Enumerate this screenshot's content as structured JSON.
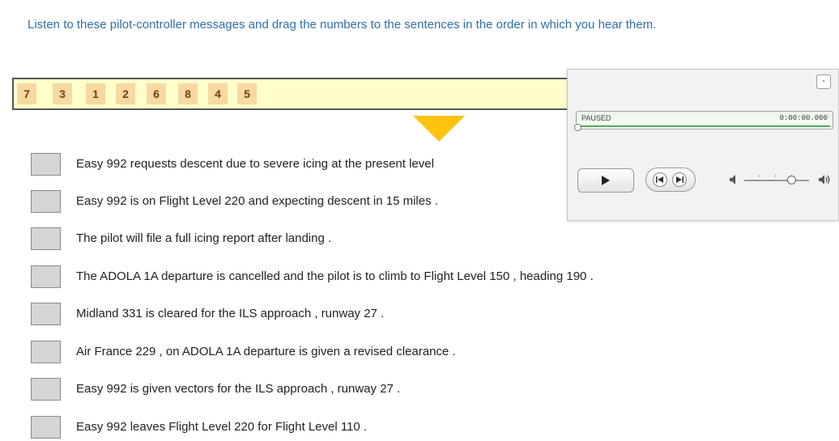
{
  "instructions": "Listen to these pilot-controller messages and drag the numbers to the sentences in the order in which you hear them.",
  "number_bank": [
    "7",
    "3",
    "1",
    "2",
    "6",
    "8",
    "4",
    "5"
  ],
  "sentences": [
    "Easy 992 requests descent due to severe icing at the present level",
    "Easy 992 is on Flight Level 220 and expecting descent in 15 miles .",
    "The pilot will file a full icing report after landing .",
    "The ADOLA 1A departure is cancelled and the pilot is to climb to Flight Level 150 , heading 190 .",
    "Midland 331 is cleared for the ILS approach , runway 27 .",
    "Air France 229 , on ADOLA 1A departure is given a revised clearance .",
    "Easy 992 is given vectors for the ILS approach , runway 27 .",
    "Easy 992 leaves Flight Level 220 for Flight Level 110 ."
  ],
  "player": {
    "collapse_label": "-",
    "status": "PAUSED",
    "time": "0:00:00.000",
    "progress": 0,
    "volume": 0.75
  },
  "colors": {
    "instructions": "#2f6fa8",
    "bank_background": "#ffffcc",
    "tile_background": "#f7d9a1",
    "tile_text": "#7a3b12",
    "arrow": "#ffc20e",
    "drop_box": "#d5d5d5",
    "progress": "#4caf50"
  },
  "icons": {
    "play": "play-icon",
    "previous": "skip-back-icon",
    "next": "skip-forward-icon",
    "volume_low": "speaker-low-icon",
    "volume_high": "speaker-high-icon",
    "arrow": "drop-arrow-icon"
  }
}
